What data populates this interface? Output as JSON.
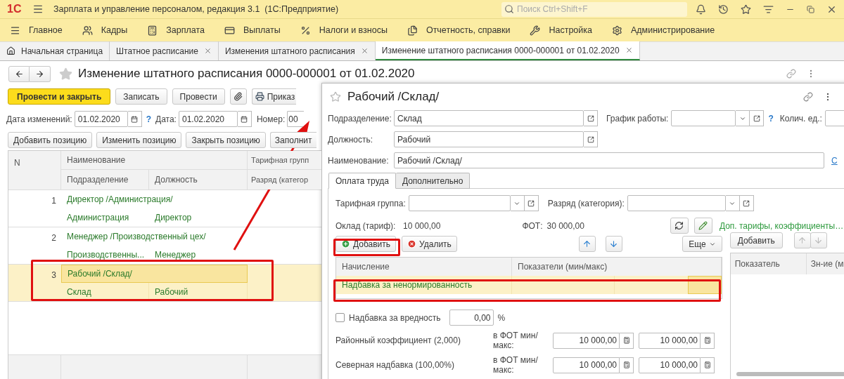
{
  "app_bar": {
    "logo": "1С",
    "title": "Зарплата и управление персоналом, редакция 3.1  (1С:Предприятие)",
    "search": {
      "placeholder": "Поиск Ctrl+Shift+F"
    }
  },
  "sections": [
    "Главное",
    "Кадры",
    "Зарплата",
    "Выплаты",
    "Налоги и взносы",
    "Отчетность, справки",
    "Настройка",
    "Администрирование"
  ],
  "open_tabs": [
    {
      "label": "Начальная страница",
      "selected": false,
      "closable": false
    },
    {
      "label": "Штатное расписание",
      "selected": false,
      "closable": true
    },
    {
      "label": "Изменения штатного расписания",
      "selected": false,
      "closable": true
    },
    {
      "label": "Изменение штатного расписания 0000-000001 от 01.02.2020",
      "selected": true,
      "closable": true
    }
  ],
  "form": {
    "title": "Изменение штатного расписания 0000-000001 от 01.02.2020",
    "buttons": [
      {
        "kind": "primary",
        "label": "Провести и закрыть"
      },
      {
        "kind": "plain",
        "label": "Записать"
      },
      {
        "kind": "plain",
        "label": "Провести"
      },
      {
        "kind": "attach"
      },
      {
        "kind": "print",
        "label": "Приказ"
      }
    ],
    "change_date": {
      "label": "Дата изменений:",
      "value": "01.02.2020"
    },
    "help": "?",
    "date": {
      "label": "Дата:",
      "value": "01.02.2020"
    },
    "number": {
      "label": "Номер:",
      "value": "00"
    },
    "position_buttons": [
      "Добавить позицию",
      "Изменить позицию",
      "Закрыть позицию",
      "Заполнит"
    ],
    "table": {
      "header_top": [
        "N",
        "Наименование",
        "Тарифная групп"
      ],
      "header_bottom": [
        "Подразделение",
        "Должность",
        "Разряд (категор"
      ],
      "rows": [
        {
          "n": "1",
          "name": "Директор /Администрация/",
          "department": "Администрация",
          "position": "Директор",
          "selected": false
        },
        {
          "n": "2",
          "name": "Менеджер /Производственный цех/",
          "department": "Производственны...",
          "position": "Менеджер",
          "selected": false
        },
        {
          "n": "3",
          "name": "Рабочий /Склад/",
          "department": "Склад",
          "position": "Рабочий",
          "selected": true
        }
      ]
    }
  },
  "dialog": {
    "title": "Рабочий /Склад/",
    "department": {
      "label": "Подразделение:",
      "value": "Склад"
    },
    "schedule": {
      "label": "График работы:"
    },
    "help": "?",
    "units": {
      "label": "Колич. ед.:"
    },
    "position": {
      "label": "Должность:",
      "value": "Рабочий"
    },
    "name": {
      "label": "Наименование:",
      "value": "Рабочий /Склад/"
    },
    "name_link": "С",
    "tabs": [
      {
        "label": "Оплата труда",
        "selected": true
      },
      {
        "label": "Дополнительно",
        "selected": false
      }
    ],
    "tariff_group": {
      "label": "Тарифная группа:"
    },
    "grade": {
      "label": "Разряд (категория):"
    },
    "salary": {
      "label": "Оклад (тариф):",
      "value": "10 000,00"
    },
    "payroll": {
      "label": "ФОТ:",
      "value": "30 000,00"
    },
    "extra_link": "Доп. тарифы, коэффициенты…",
    "add": "Добавить",
    "delete": "Удалить",
    "more": "Еще",
    "accruals": {
      "columns": [
        "Начисление",
        "Показатели (мин/макс)"
      ],
      "rows": [
        {
          "name": "Надбавка за ненормированность",
          "selected": true
        }
      ]
    },
    "hazard": {
      "label": "Надбавка за вредность",
      "checked": false,
      "value": "0,00",
      "unit": "%"
    },
    "allowances": [
      {
        "label": "Районный коэффициент (2,000)",
        "note": "в ФОТ мин/макс:",
        "min": "10 000,00",
        "max": "10 000,00"
      },
      {
        "label": "Северная надбавка (100,00%)",
        "note": "в ФОТ мин/макс:",
        "min": "10 000,00",
        "max": "10 000,00"
      }
    ],
    "side": {
      "add": "Добавить",
      "columns": [
        "Показатель",
        "Зн-ие (м"
      ]
    }
  }
}
